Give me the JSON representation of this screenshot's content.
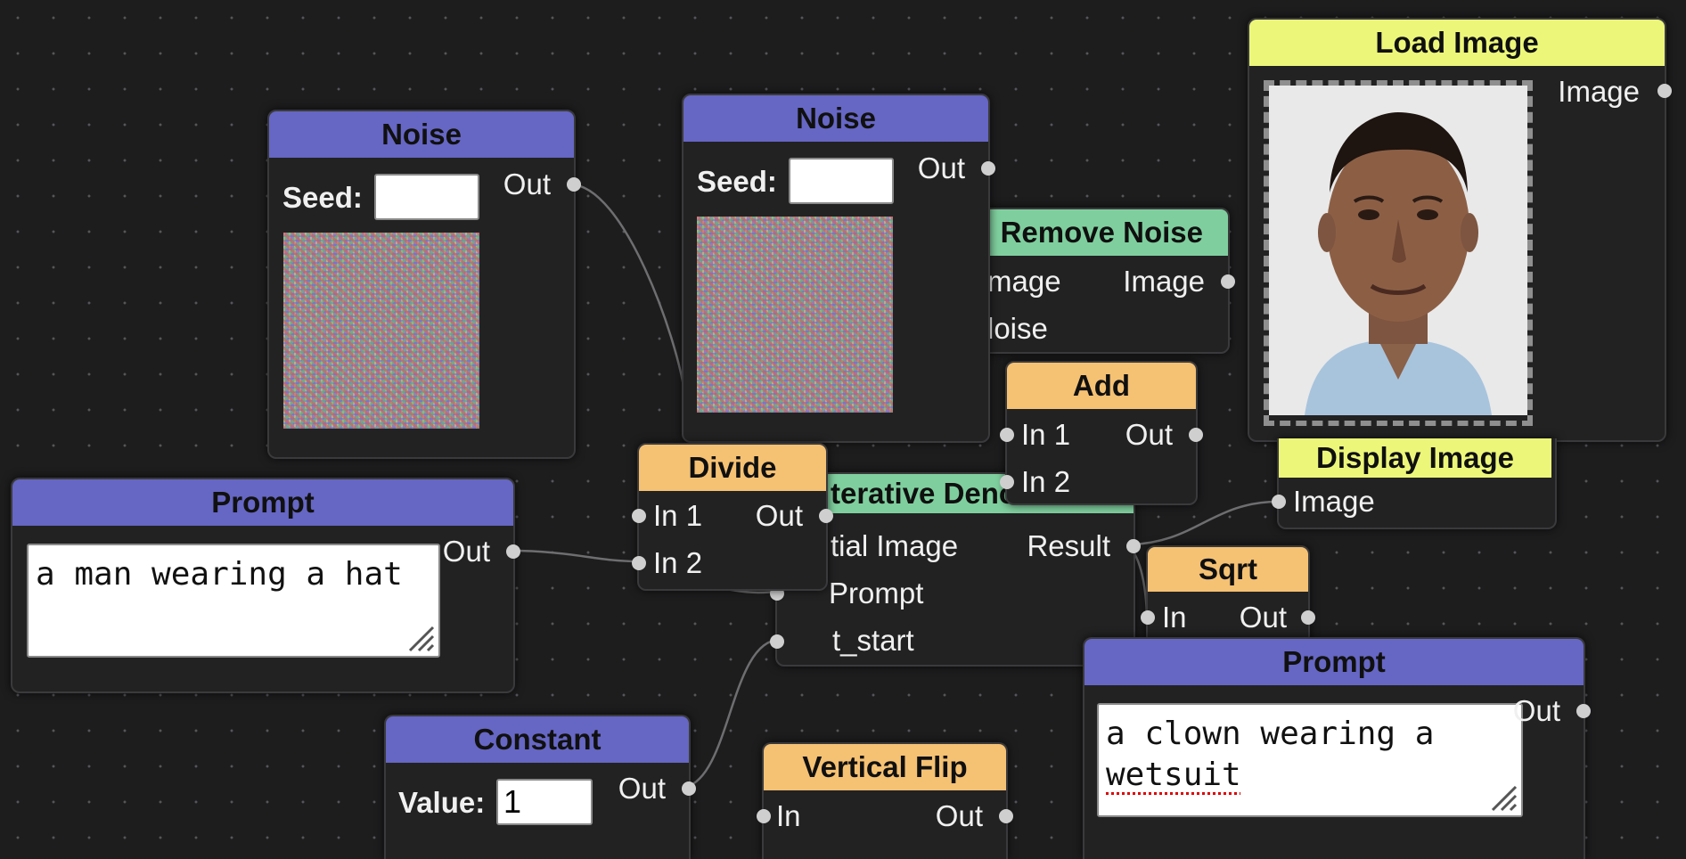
{
  "nodes": {
    "noise1": {
      "title": "Noise",
      "seed_label": "Seed:",
      "seed_value": "",
      "out": "Out"
    },
    "noise2": {
      "title": "Noise",
      "seed_label": "Seed:",
      "seed_value": "",
      "out": "Out"
    },
    "remove_noise": {
      "title": "Remove Noise",
      "in_image": "mage",
      "in_noise": "loise",
      "out_image": "Image"
    },
    "load_image": {
      "title": "Load Image",
      "out_image": "Image"
    },
    "add": {
      "title": "Add",
      "in1": "In 1",
      "in2": "In 2",
      "out": "Out"
    },
    "display_image": {
      "title": "Display Image",
      "in_image": "Image"
    },
    "divide": {
      "title": "Divide",
      "in1": "In 1",
      "in2": "In 2",
      "out": "Out"
    },
    "iterative_denoise": {
      "title": "terative Denoise",
      "in_initial": "tial Image",
      "in_prompt": "Prompt",
      "in_tstart": "t_start",
      "out_result": "Result"
    },
    "prompt1": {
      "title": "Prompt",
      "text": "a man wearing a hat",
      "out": "Out"
    },
    "sqrt": {
      "title": "Sqrt",
      "in": "In",
      "out": "Out"
    },
    "prompt2": {
      "title": "Prompt",
      "text_line1": "a clown wearing a",
      "text_line2": "wetsuit",
      "out": "Out"
    },
    "constant": {
      "title": "Constant",
      "value_label": "Value:",
      "value": "1",
      "out": "Out"
    },
    "vertical_flip": {
      "title": "Vertical Flip",
      "in": "In",
      "out": "Out"
    }
  },
  "icons": {
    "resize_grip": "resize-grip-icon",
    "portrait": "portrait-image"
  },
  "colors": {
    "primitive_header": "#6666c4",
    "math_header": "#f5c173",
    "model_header": "#7fcf9e",
    "image_header": "#ecf77a",
    "canvas": "#1d1d1e"
  }
}
